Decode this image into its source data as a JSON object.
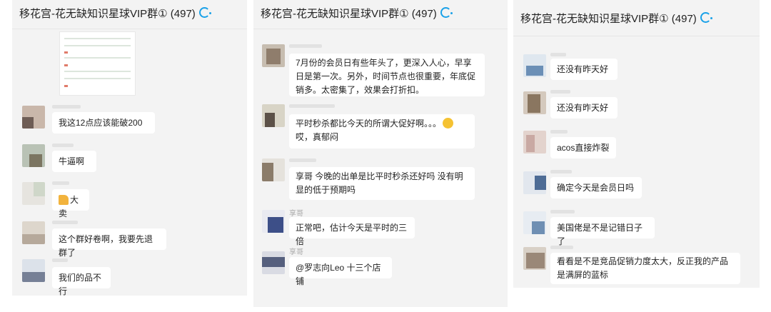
{
  "panels": [
    {
      "title": "移花宫-花无缺知识星球VIP群① (497)",
      "messages": [
        {
          "text": "我这12点应该能破200"
        },
        {
          "text": "牛逼啊"
        },
        {
          "text": "大卖",
          "emoji": "thumbs-up-icon"
        },
        {
          "text": "这个群好卷啊，我要先退群了"
        },
        {
          "text": "我们的品不行"
        }
      ]
    },
    {
      "title": "移花宫-花无缺知识星球VIP群① (497)",
      "messages": [
        {
          "text": "7月份的会员日有些年头了，更深入人心，早享日是第一次。另外，时间节点也很重要，年底促销多。太密集了，效果会打折扣。"
        },
        {
          "text_before": "平时秒杀都比今天的所谓大促好啊。。。",
          "emoji": "smile-icon",
          "text_after": "哎，真郁闷"
        },
        {
          "text": "享哥 今晚的出单是比平时秒杀还好吗 没有明显的低于预期吗"
        },
        {
          "sender": "享哥",
          "text": "正常吧，估计今天是平时的三倍"
        },
        {
          "sender": "享哥",
          "text": "@罗志向Leo 十三个店铺"
        }
      ]
    },
    {
      "title": "移花宫-花无缺知识星球VIP群① (497)",
      "messages": [
        {
          "text": "还没有昨天好"
        },
        {
          "text": "还没有昨天好"
        },
        {
          "text": "acos直接炸裂"
        },
        {
          "text": "确定今天是会员日吗"
        },
        {
          "text": "美国佬是不是记错日子了"
        },
        {
          "text": "看看是不是竞品促销力度太大，反正我的产品是满屏的蓝标"
        }
      ]
    }
  ],
  "colors": {
    "accent": "#1aa1e8",
    "panel_bg": "#f3f3f3",
    "bubble_bg": "#ffffff"
  }
}
